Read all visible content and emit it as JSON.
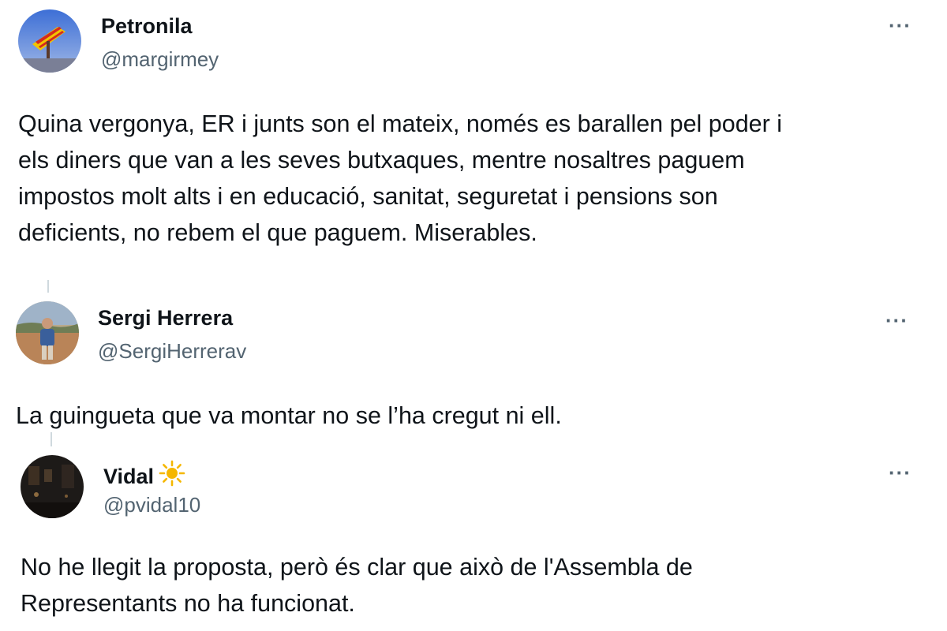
{
  "tweets": [
    {
      "display_name": "Petronila",
      "handle": "@margirmey",
      "more_label": "···",
      "body_lines": [
        "Quina vergonya, ER i junts son el mateix, només es barallen pel poder i",
        "els diners que van a les seves butxaques, mentre nosaltres paguem",
        "impostos molt alts i  en educació, sanitat, seguretat i pensions son",
        "deficients, no rebem el que paguem. Miserables."
      ]
    },
    {
      "display_name": "Sergi Herrera",
      "handle": "@SergiHerrerav",
      "more_label": "···",
      "body_lines": [
        "La guingueta que va montar no se l’ha cregut ni ell."
      ]
    },
    {
      "display_name": "Vidal",
      "name_emoji": "sun-icon",
      "handle": "@pvidal10",
      "more_label": "···",
      "body_lines": [
        "No he llegit la proposta, però és clar que això de l'Assembla de",
        "Representants no ha funcionat."
      ]
    }
  ],
  "colors": {
    "text": "#0f1419",
    "secondary": "#536471",
    "thread_line": "#cfd9de",
    "sun": "#f5b700"
  }
}
